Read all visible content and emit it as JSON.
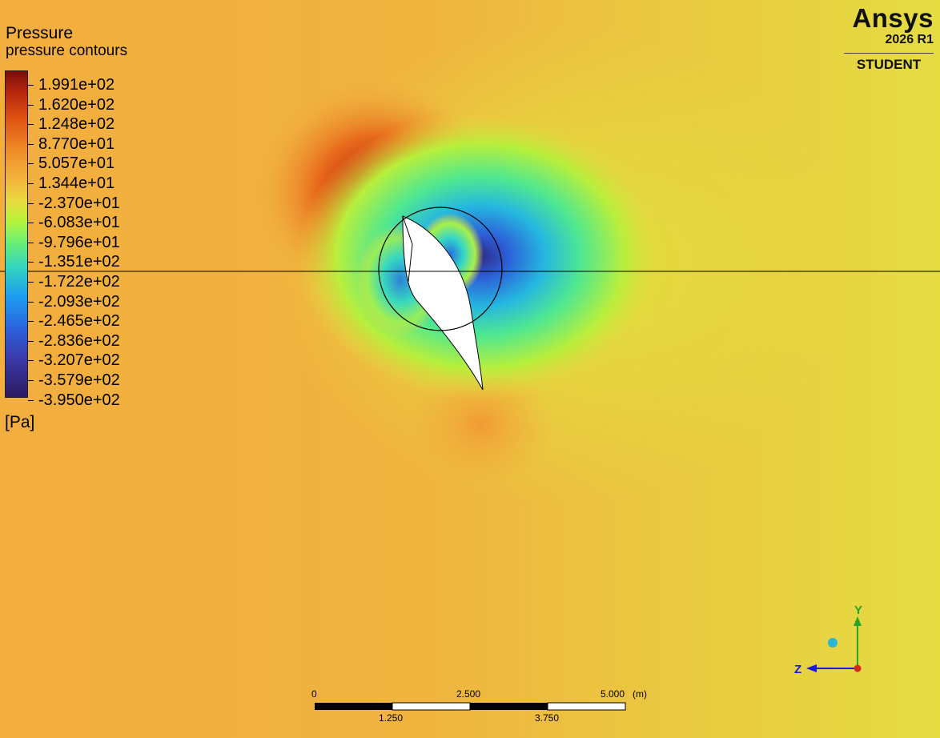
{
  "legend": {
    "title": "Pressure",
    "subtitle": "pressure contours",
    "units": "[Pa]",
    "ticks": [
      "1.991e+02",
      "1.620e+02",
      "1.248e+02",
      "8.770e+01",
      "5.057e+01",
      "1.344e+01",
      "-2.370e+01",
      "-6.083e+01",
      "-9.796e+01",
      "-1.351e+02",
      "-1.722e+02",
      "-2.093e+02",
      "-2.465e+02",
      "-2.836e+02",
      "-3.207e+02",
      "-3.579e+02",
      "-3.950e+02"
    ]
  },
  "logo": {
    "name": "Ansys",
    "version": "2026 R1",
    "edition": "STUDENT"
  },
  "axes": {
    "y_label": "Y",
    "z_label": "Z",
    "y_color": "#22a822",
    "z_color": "#1a1ad6"
  },
  "scale_bar": {
    "top_labels": [
      "0",
      "2.500",
      "5.000"
    ],
    "unit": "(m)",
    "bottom_labels": [
      "1.250",
      "3.750"
    ]
  }
}
